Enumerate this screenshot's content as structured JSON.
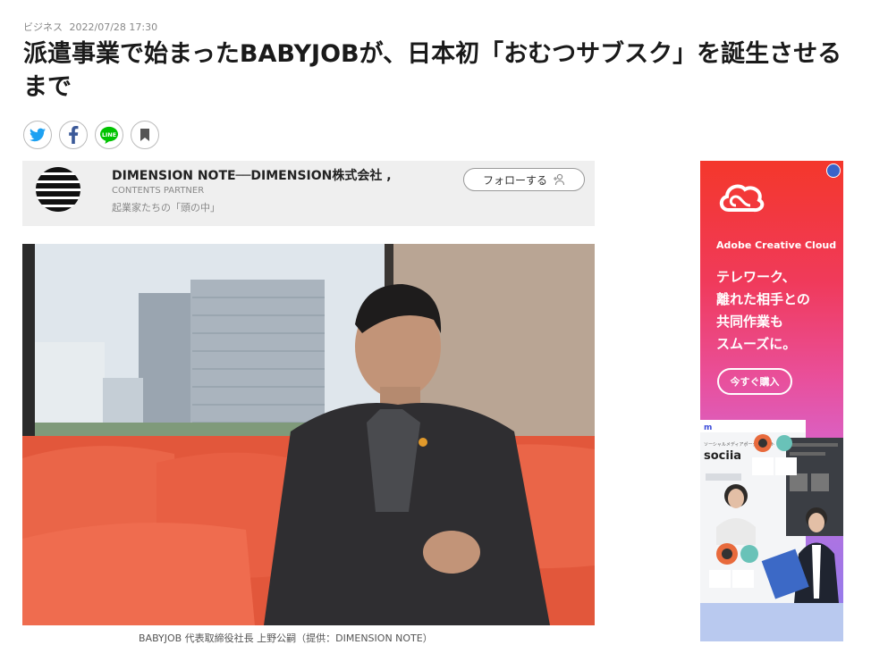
{
  "meta": {
    "category": "ビジネス",
    "datetime": "2022/07/28 17:30"
  },
  "article": {
    "title": "派遣事業で始まったBABYJOBが、日本初「おむつサブスク」を誕生させるまで",
    "caption": "BABYJOB 代表取締役社長 上野公嗣（提供：DIMENSION NOTE）"
  },
  "share": [
    {
      "name": "twitter",
      "icon": "twitter-icon",
      "color": "#1da1f2"
    },
    {
      "name": "facebook",
      "icon": "facebook-icon",
      "color": "#3b5998"
    },
    {
      "name": "line",
      "icon": "line-icon",
      "color": "#00c300"
    },
    {
      "name": "bookmark",
      "icon": "bookmark-icon",
      "color": "#555555"
    }
  ],
  "author": {
    "name": "DIMENSION NOTE──DIMENSION株式会社 ,",
    "role": "CONTENTS PARTNER",
    "description": "起業家たちの「頭の中」",
    "follow_label": "フォローする"
  },
  "ad": {
    "brand": "Adobe Creative Cloud",
    "copy_lines": [
      "テレワーク、",
      "離れた相手との",
      "共同作業も",
      "スムーズに。"
    ],
    "cta": "今すぐ購入",
    "screen_title": "sociia",
    "screen_subtitle": "ソーシャルメディアポータルサイト"
  }
}
